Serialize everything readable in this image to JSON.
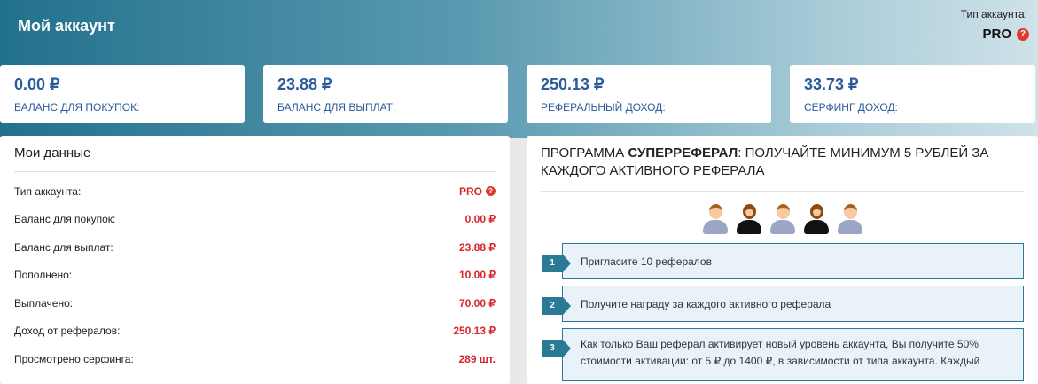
{
  "header": {
    "title": "Мой аккаунт",
    "account_type_label": "Тип аккаунта:",
    "account_type": "PRO",
    "help_icon": "?"
  },
  "stats": [
    {
      "value": "0.00 ₽",
      "label": "Баланс для покупок:"
    },
    {
      "value": "23.88 ₽",
      "label": "Баланс для выплат:"
    },
    {
      "value": "250.13 ₽",
      "label": "Реферальный доход:"
    },
    {
      "value": "33.73 ₽",
      "label": "Серфинг доход:"
    }
  ],
  "my_data": {
    "title": "Мои данные",
    "rows": [
      {
        "label": "Тип аккаунта:",
        "value": "PRO"
      },
      {
        "label": "Баланс для покупок:",
        "value": "0.00 ₽"
      },
      {
        "label": "Баланс для выплат:",
        "value": "23.88 ₽"
      },
      {
        "label": "Пополнено:",
        "value": "10.00 ₽"
      },
      {
        "label": "Выплачено:",
        "value": "70.00 ₽"
      },
      {
        "label": "Доход от рефералов:",
        "value": "250.13 ₽"
      },
      {
        "label": "Просмотрено серфинга:",
        "value": "289 шт."
      }
    ]
  },
  "program": {
    "title_prefix": "ПРОГРАММА ",
    "title_bold": "СУПЕРРЕФЕРАЛ",
    "title_suffix": ": ПОЛУЧАЙТЕ МИНИМУМ 5 РУБЛЕЙ ЗА КАЖДОГО АКТИВНОГО РЕФЕРАЛА",
    "steps": [
      {
        "n": "1",
        "text": "Пригласите 10 рефералов"
      },
      {
        "n": "2",
        "text": "Получите награду за каждого активного реферала"
      },
      {
        "n": "3",
        "text": "Как только Ваш реферал активирует новый уровень аккаунта, Вы получите 50% стоимости активации: от 5 ₽ до 1400 ₽, в зависимости от типа аккаунта. Каждый"
      }
    ]
  }
}
